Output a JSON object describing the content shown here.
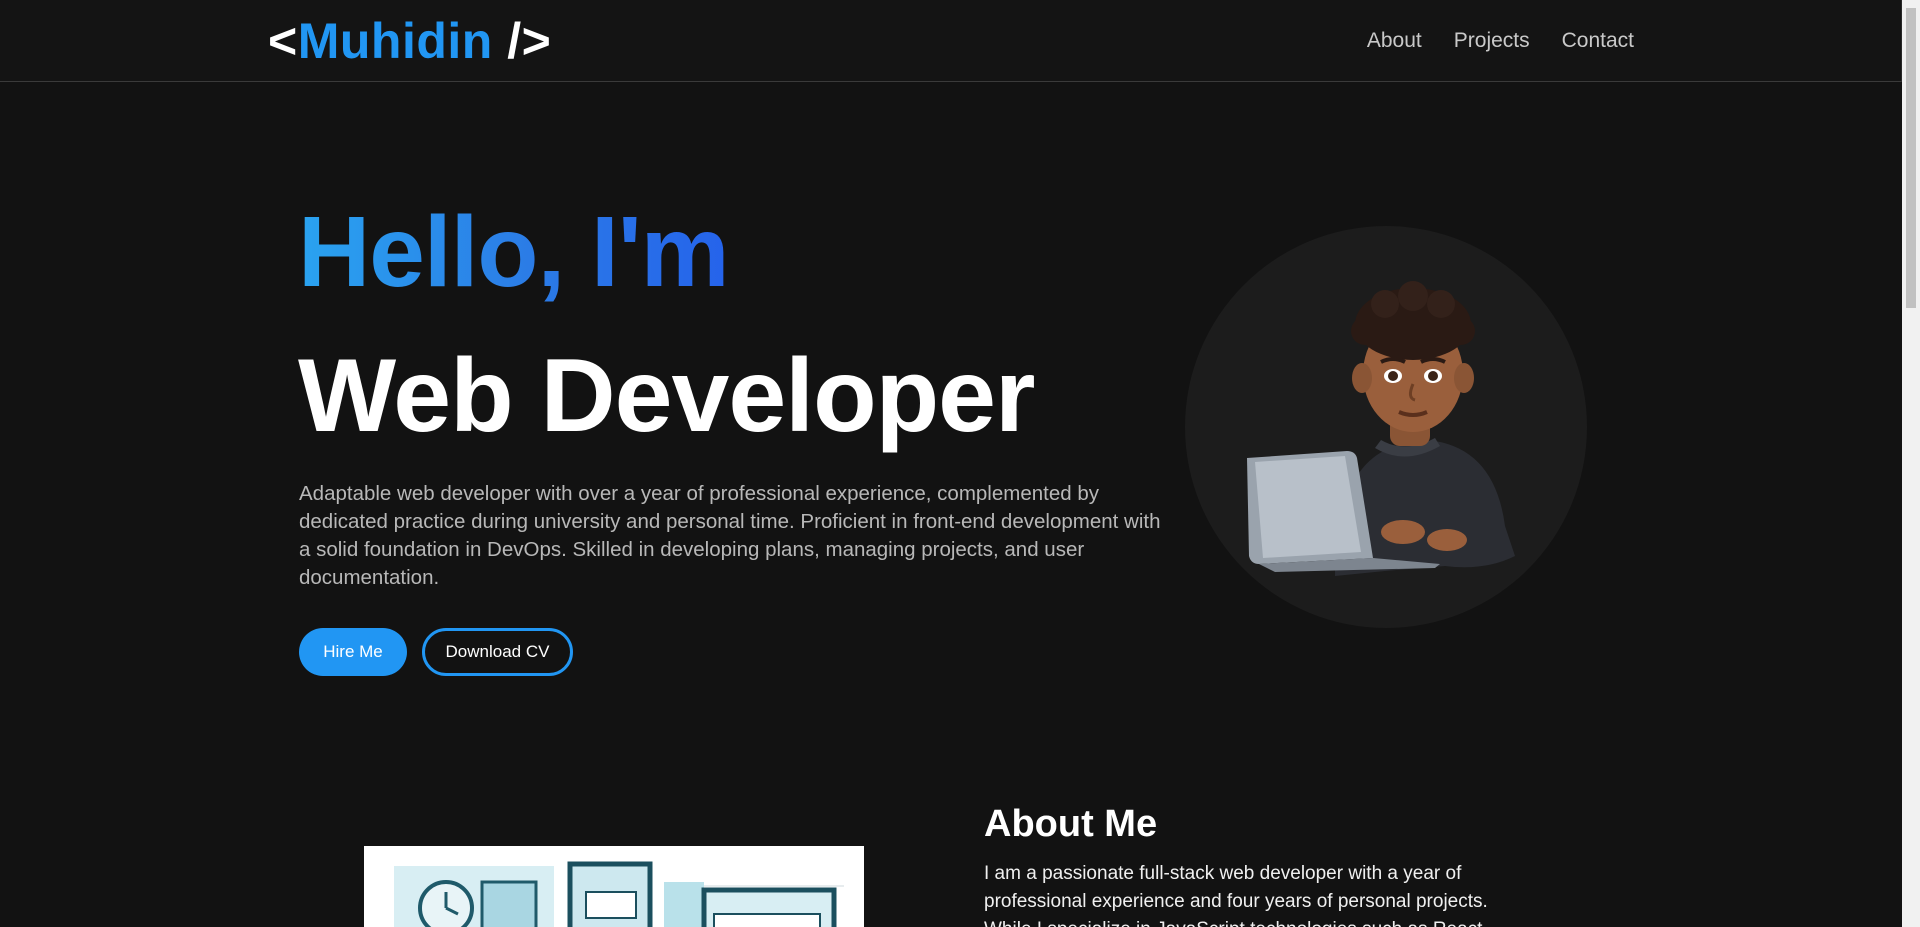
{
  "nav": {
    "logo_open": "<",
    "logo_name": "Muhidin",
    "logo_close": " />",
    "links": [
      "About",
      "Projects",
      "Contact"
    ]
  },
  "hero": {
    "greeting": "Hello, I'm",
    "role": "Web Developer",
    "description": "Adaptable web developer with over a year of professional experience, complemented by dedicated practice during university and personal time. Proficient in front-end development with a solid foundation in DevOps. Skilled in developing plans, managing projects, and user documentation.",
    "hire_label": "Hire Me",
    "cv_label": "Download CV"
  },
  "about": {
    "title": "About Me",
    "text": "I am a passionate full-stack web developer with a year of professional experience and four years of personal projects. While I specialize in JavaScript technologies such as React"
  },
  "colors": {
    "accent": "#2196f3",
    "background": "#121212",
    "navbar": "#141414"
  }
}
